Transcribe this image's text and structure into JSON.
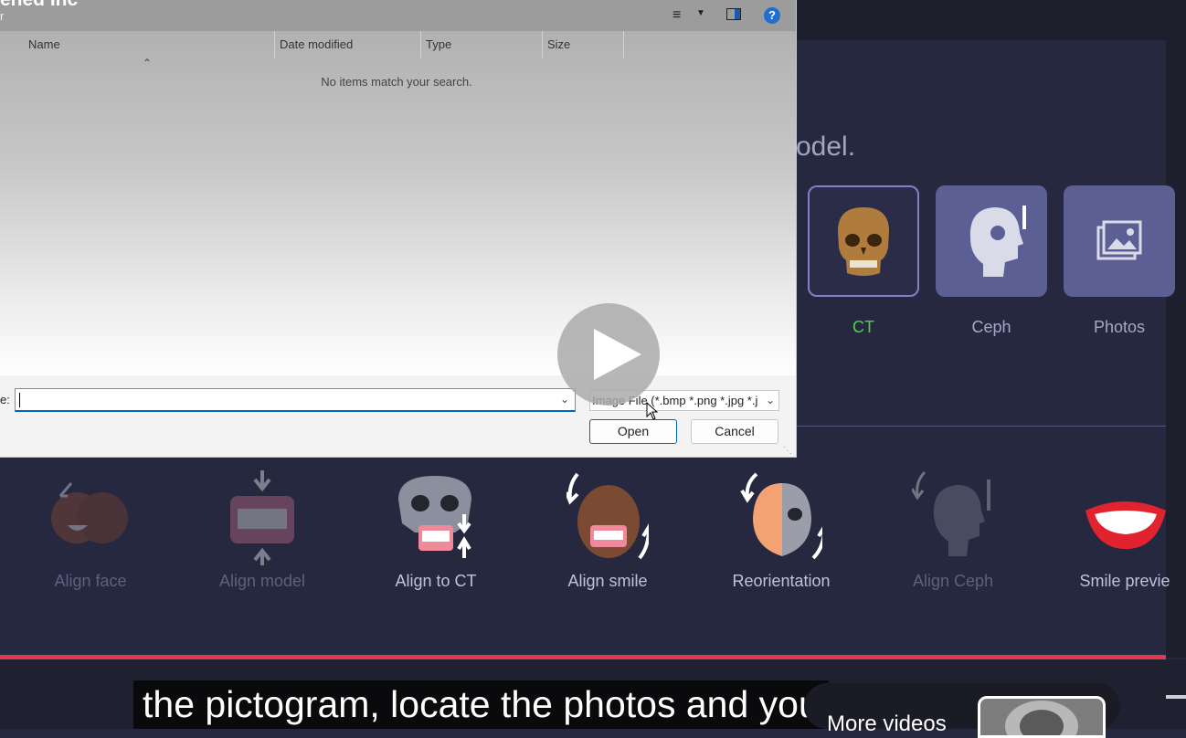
{
  "dialog": {
    "title": "ened Inc",
    "subtitle": "r",
    "columns": {
      "name": "Name",
      "date": "Date modified",
      "type": "Type",
      "size": "Size"
    },
    "empty_message": "No items match your search.",
    "filename_label": "e:",
    "filename_value": "",
    "filetype_selected": "Image File (*.bmp *.png *.jpg *.j",
    "open_label": "Open",
    "cancel_label": "Cancel",
    "icons": [
      "view-list-icon",
      "chevron-down-icon",
      "preview-pane-icon",
      "help-icon"
    ]
  },
  "app": {
    "hint": "odel.",
    "sources": [
      {
        "label": "CT",
        "selected": true,
        "icon": "skull-ct-icon"
      },
      {
        "label": "Ceph",
        "selected": false,
        "icon": "ceph-xray-icon"
      },
      {
        "label": "Photos",
        "selected": false,
        "icon": "photos-icon"
      }
    ],
    "tools": [
      {
        "label": "Align face",
        "enabled": false
      },
      {
        "label": "Align model",
        "enabled": false
      },
      {
        "label": "Align to CT",
        "enabled": true
      },
      {
        "label": "Align smile",
        "enabled": true
      },
      {
        "label": "Reorientation",
        "enabled": true
      },
      {
        "label": "Align Ceph",
        "enabled": false
      },
      {
        "label": "Smile previe",
        "enabled": true
      }
    ],
    "colors": {
      "active_green": "#4fd14f",
      "accent_red": "#e0394f",
      "tile_purple": "#5b5f94"
    }
  },
  "player": {
    "caption": "the pictogram, locate the photos and you",
    "more_videos": "More videos"
  }
}
